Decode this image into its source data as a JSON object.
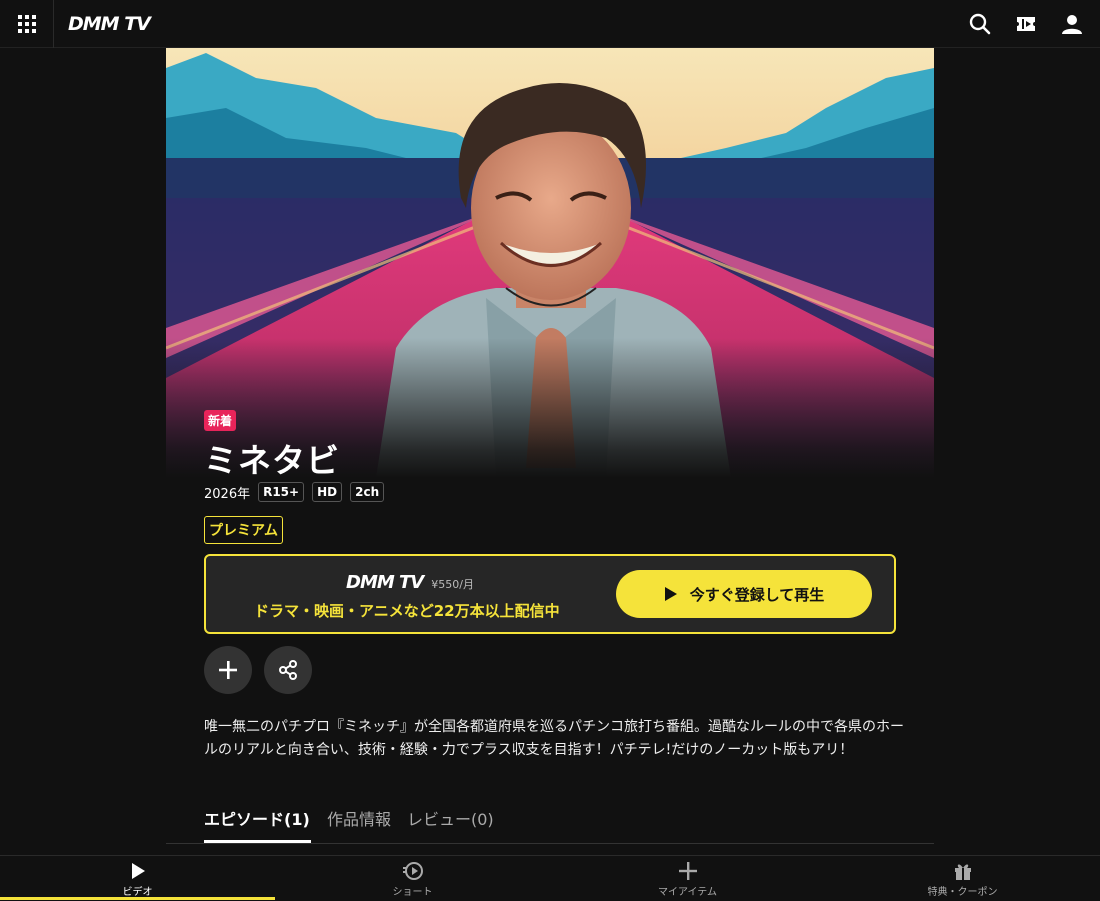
{
  "header": {
    "logo": "DMM TV",
    "icons": [
      "grid-menu-icon",
      "search-icon",
      "ticket-icon",
      "user-icon"
    ]
  },
  "hero": {
    "badge": "新着",
    "title": "ミネタビ"
  },
  "meta": {
    "year": "2026年",
    "tags": [
      "R15+",
      "HD",
      "2ch"
    ]
  },
  "premium_label": "プレミアム",
  "promo": {
    "logo": "DMM TV",
    "price": "¥550/月",
    "tagline": "ドラマ・映画・アニメなど22万本以上配信中",
    "cta_label": "今すぐ登録して再生"
  },
  "description": "唯一無二のパチプロ『ミネッチ』が全国各都道府県を巡るパチンコ旅打ち番組。過酷なルールの中で各県のホールのリアルと向き合い、技術・経験・力でプラス収支を目指す！パチテレ!だけのノーカット版もアリ！",
  "tabs": [
    {
      "label": "エピソード(1)",
      "active": true
    },
    {
      "label": "作品情報",
      "active": false
    },
    {
      "label": "レビュー(0)",
      "active": false
    }
  ],
  "bottom_nav": [
    {
      "label": "ビデオ",
      "icon": "play-icon",
      "active": true
    },
    {
      "label": "ショート",
      "icon": "short-play-icon",
      "active": false
    },
    {
      "label": "マイアイテム",
      "icon": "plus-icon",
      "active": false
    },
    {
      "label": "特典・クーポン",
      "icon": "gift-icon",
      "active": false
    }
  ],
  "colors": {
    "accent": "#f5e33a",
    "new_badge": "#e8245a",
    "background": "#111111"
  }
}
